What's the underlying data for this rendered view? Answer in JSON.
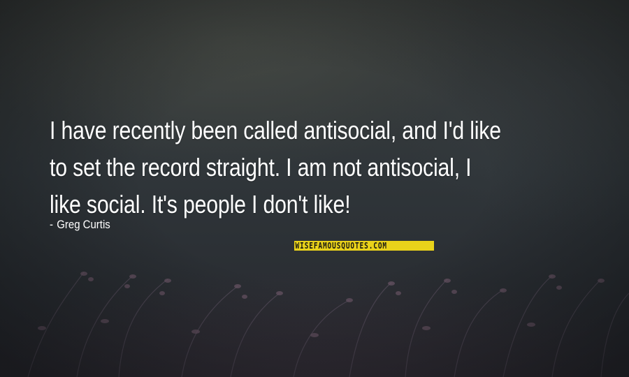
{
  "quote": {
    "lines": [
      "I have recently been called antisocial, and I'd like",
      "to set the record straight. I am not antisocial, I",
      "like social. It's people I don't like!"
    ]
  },
  "author": {
    "dash": "-",
    "name": "Greg Curtis"
  },
  "watermark": {
    "text": "WISEFAMOUSQUOTES.COM",
    "color": "#e9d21a"
  },
  "background": {
    "description_colors": [
      "#3a3d3b",
      "#30363a",
      "#2b2a31"
    ]
  }
}
